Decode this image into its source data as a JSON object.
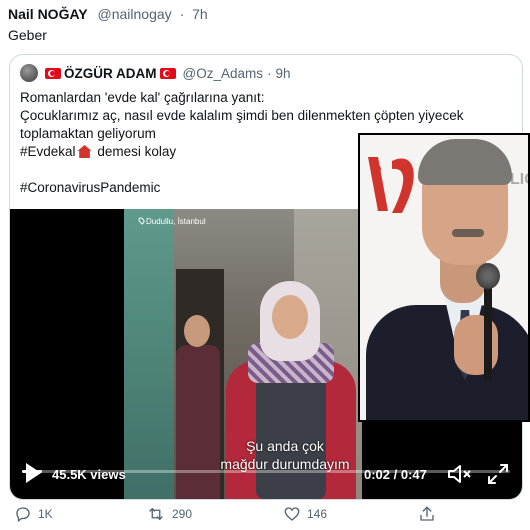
{
  "tweet": {
    "author_name": "Nail NOĞAY",
    "author_handle": "@nailnogay",
    "separator": "·",
    "time": "7h",
    "text": "Geber"
  },
  "quote": {
    "author_name": "ÖZGÜR ADAM",
    "author_handle": "@Oz_Adams",
    "separator": "·",
    "time": "9h",
    "lines": [
      "Romanlardan 'evde kal' çağrılarına yanıt:",
      "Çocuklarımız aç, nasıl evde kalalım şimdi ben dilenmekten çöpten yiyecek",
      "toplamaktan geliyorum",
      "#Evdekal",
      "demesi kolay",
      "#CoronavirusPandemic"
    ]
  },
  "video": {
    "location_label": "Dudullu, İstanbul",
    "subtitle_line1": "Şu anda çok",
    "subtitle_line2": "mağdur durumdayım",
    "views": "45.5K views",
    "time_display": "0:02 / 0:47",
    "progress": 0.04
  },
  "actions": {
    "replies": "1K",
    "retweets": "290",
    "likes": "146"
  },
  "overlay": {
    "logo_letters": "LIC"
  },
  "colors": {
    "text": "#0f1419",
    "muted": "#536471",
    "border": "#cfd9de",
    "flag_red": "#e30a17"
  }
}
